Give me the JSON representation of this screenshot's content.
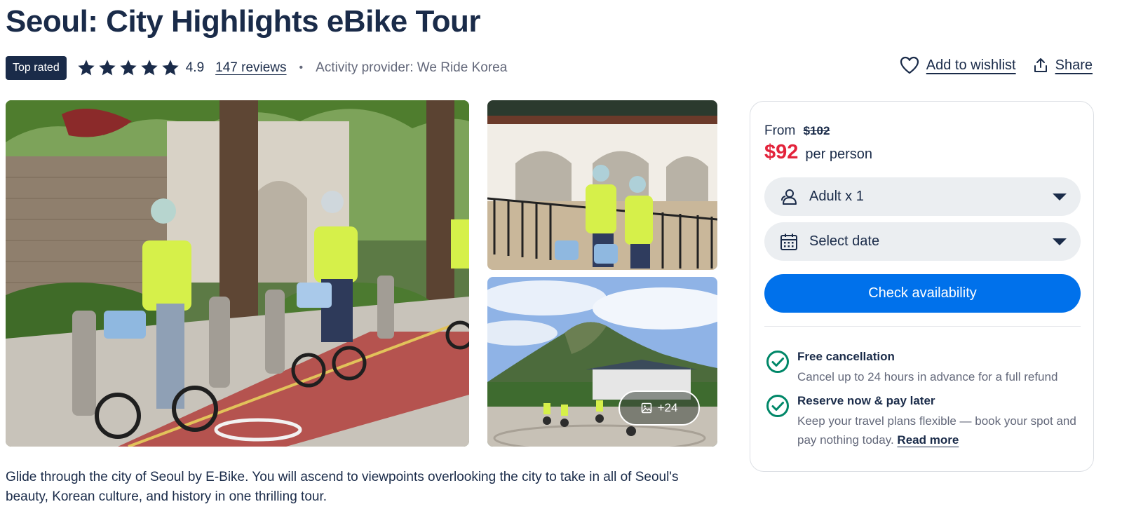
{
  "header": {
    "title": "Seoul: City Highlights eBike Tour",
    "badge": "Top rated",
    "rating": "4.9",
    "star_count": 5,
    "reviews_link": "147 reviews",
    "separator": "•",
    "provider": "Activity provider: We Ride Korea"
  },
  "actions": {
    "wishlist_label": "Add to wishlist",
    "wishlist_icon": "heart-icon",
    "share_label": "Share",
    "share_icon": "share-icon"
  },
  "gallery": {
    "images": [
      {
        "name": "main-photo",
        "depicts": "riders on e-bikes on red bike lane"
      },
      {
        "name": "palace-photo",
        "depicts": "two riders posing at palace gate"
      },
      {
        "name": "mountain-photo",
        "depicts": "mountain view with riders"
      }
    ],
    "more_photos_label": "+24",
    "more_photos_icon": "image-icon"
  },
  "description": "Glide through the city of Seoul by E-Bike. You will ascend to viewpoints overlooking the city to take in all of Seoul's beauty, Korean culture, and history in one thrilling tour.",
  "booking": {
    "from_label": "From",
    "old_price": "$102",
    "price": "$92",
    "per_person": "per person",
    "participants": {
      "label": "Adult x 1",
      "icon": "people-icon"
    },
    "date": {
      "label": "Select date",
      "icon": "calendar-icon"
    },
    "check_button": "Check availability",
    "features": [
      {
        "title": "Free cancellation",
        "text": "Cancel up to 24 hours in advance for a full refund",
        "icon": "check-circle-icon"
      },
      {
        "title": "Reserve now & pay later",
        "text": "Keep your travel plans flexible — book your spot and pay nothing today.",
        "link": "Read more",
        "icon": "check-circle-icon"
      }
    ]
  },
  "colors": {
    "navy": "#1a2b49",
    "price_red": "#e3233b",
    "primary_blue": "#0071eb",
    "success_green": "#008768",
    "muted": "#63687a"
  }
}
